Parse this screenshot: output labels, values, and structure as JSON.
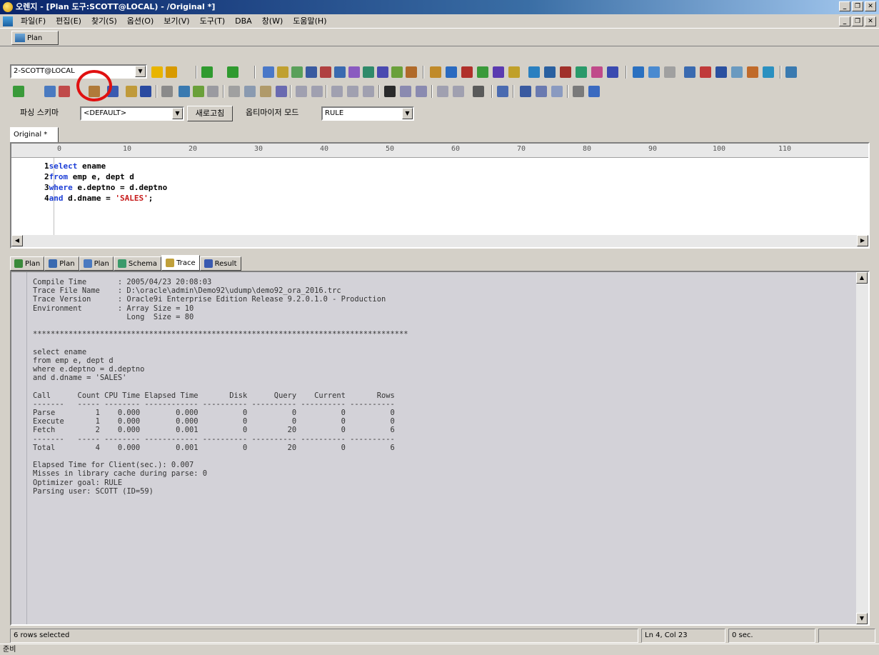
{
  "window": {
    "title": "오렌지 - [Plan 도구:SCOTT@LOCAL) - /Original *]"
  },
  "menus": [
    "파일(F)",
    "편집(E)",
    "찾기(S)",
    "옵션(O)",
    "보기(V)",
    "도구(T)",
    "DBA",
    "창(W)",
    "도움말(H)"
  ],
  "doc_tab": {
    "label": "Plan"
  },
  "connection_combo": {
    "value": "2-SCOTT@LOCAL"
  },
  "parse_row": {
    "script_label": "파싱 스키마",
    "script_value": "<DEFAULT>",
    "refresh_button": "새로고침",
    "optimizer_label": "옵티마이저 모드",
    "optimizer_value": "RULE"
  },
  "editor": {
    "tab_label": "Original *",
    "ruler": [
      "0",
      "10",
      "20",
      "30",
      "40",
      "50",
      "60",
      "70",
      "80",
      "90",
      "100",
      "110"
    ],
    "lines": [
      {
        "num": "1",
        "kw": "select",
        "rest": " ename"
      },
      {
        "num": "2",
        "kw": "from",
        "rest": " emp e, dept d"
      },
      {
        "num": "3",
        "kw": "where",
        "rest": " e.deptno = d.deptno"
      },
      {
        "num": "4",
        "kw": "and",
        "rest": " d.dname = ",
        "str": "'SALES'",
        "tail": ";"
      }
    ]
  },
  "result_tabs": [
    "Plan",
    "Plan",
    "Plan",
    "Schema",
    "Trace",
    "Result"
  ],
  "trace_text": "Compile Time       : 2005/04/23 20:08:03\nTrace File Name    : D:\\oracle\\admin\\Demo92\\udump\\demo92_ora_2016.trc\nTrace Version      : Oracle9i Enterprise Edition Release 9.2.0.1.0 - Production\nEnvironment        : Array Size = 10\n                     Long  Size = 80\n\n************************************************************************************\n\nselect ename\nfrom emp e, dept d\nwhere e.deptno = d.deptno\nand d.dname = 'SALES'\n\nCall      Count CPU Time Elapsed Time       Disk      Query    Current       Rows\n-------   ----- -------- ------------ ---------- ---------- ---------- ----------\nParse         1    0.000        0.000          0          0          0          0\nExecute       1    0.000        0.000          0          0          0          0\nFetch         2    0.000        0.001          0         20          0          6\n-------   ----- -------- ------------ ---------- ---------- ---------- ----------\nTotal         4    0.000        0.001          0         20          0          6\n\nElapsed Time for Client(sec.): 0.007\nMisses in library cache during parse: 0\nOptimizer goal: RULE\nParsing user: SCOTT (ID=59)",
  "status": {
    "message": "6 rows selected",
    "position": "Ln 4, Col 23",
    "time": "0 sec."
  },
  "bottom_status": "준비",
  "colors": {
    "keyword": "#1c3ed6",
    "string": "#c71b1b",
    "highlight": "#e01010",
    "trace_bg": "#d3d2d8"
  }
}
